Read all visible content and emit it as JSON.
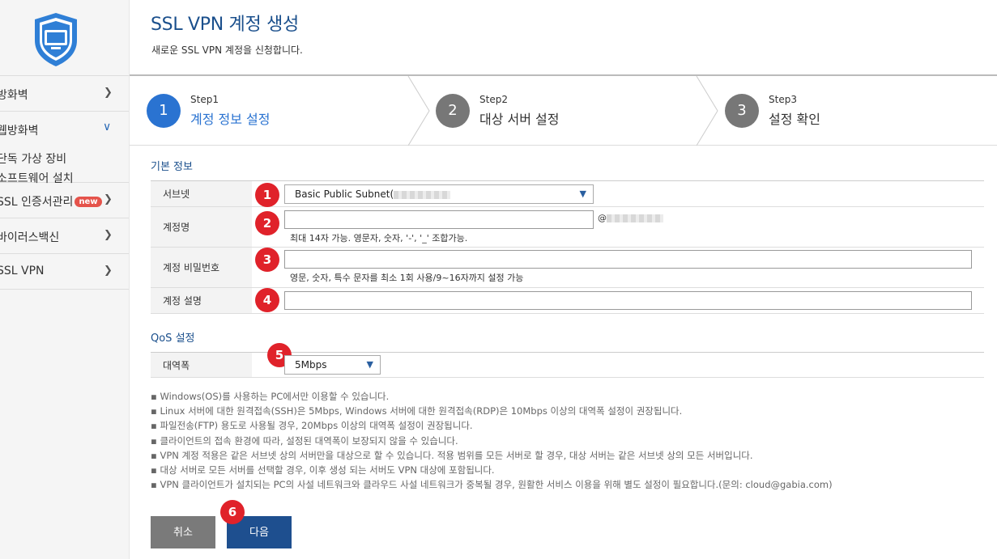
{
  "sidebar": {
    "items": [
      {
        "label": "방화벽"
      },
      {
        "label": "웹방화벽",
        "sub": [
          "단독 가상 장비",
          "소프트웨어 설치"
        ]
      },
      {
        "label": "SSL 인증서관리",
        "badge": "new"
      },
      {
        "label": "바이러스백신"
      },
      {
        "label": "SSL VPN"
      }
    ]
  },
  "header": {
    "title": "SSL VPN 계정 생성",
    "description": "새로운 SSL VPN 계정을 신청합니다."
  },
  "steps": [
    {
      "num": "1",
      "small": "Step1",
      "name": "계정 정보 설정"
    },
    {
      "num": "2",
      "small": "Step2",
      "name": "대상 서버 설정"
    },
    {
      "num": "3",
      "small": "Step3",
      "name": "설정 확인"
    }
  ],
  "basic": {
    "section_title": "기본 정보",
    "subnet_label": "서브넷",
    "subnet_value": "Basic Public Subnet(",
    "account_label": "계정명",
    "account_suffix": "@",
    "account_hint": "최대 14자 가능. 영문자, 숫자, '-', '_' 조합가능.",
    "password_label": "계정 비밀번호",
    "password_hint": "영문, 숫자, 특수 문자를 최소 1회 사용/9~16자까지 설정 가능",
    "desc_label": "계정 설명"
  },
  "qos": {
    "section_title": "QoS 설정",
    "bandwidth_label": "대역폭",
    "bandwidth_value": "5Mbps"
  },
  "markers": [
    "1",
    "2",
    "3",
    "4",
    "5",
    "6"
  ],
  "notes": [
    "Windows(OS)를 사용하는 PC에서만 이용할 수 있습니다.",
    "Linux 서버에 대한 원격접속(SSH)은 5Mbps, Windows 서버에 대한 원격접속(RDP)은 10Mbps 이상의 대역폭 설정이 권장됩니다.",
    "파일전송(FTP) 용도로 사용될 경우, 20Mbps 이상의 대역폭 설정이 권장됩니다.",
    "클라이언트의 접속 환경에 따라, 설정된 대역폭이 보장되지 않을 수 있습니다.",
    "VPN 계정 적용은 같은 서브넷 상의 서버만을 대상으로 할 수 있습니다. 적용 범위를 모든 서버로 할 경우, 대상 서버는 같은 서브넷 상의 모든 서버입니다.",
    "대상 서버로 모든 서버를 선택할 경우, 이후 생성 되는 서버도 VPN 대상에 포함됩니다.",
    "VPN 클라이언트가 설치되는 PC의 사설 네트워크와 클라우드 사설 네트워크가 중복될 경우, 원활한 서비스 이용을 위해 별도 설정이 필요합니다.(문의: cloud@gabia.com)"
  ],
  "buttons": {
    "cancel": "취소",
    "next": "다음"
  }
}
